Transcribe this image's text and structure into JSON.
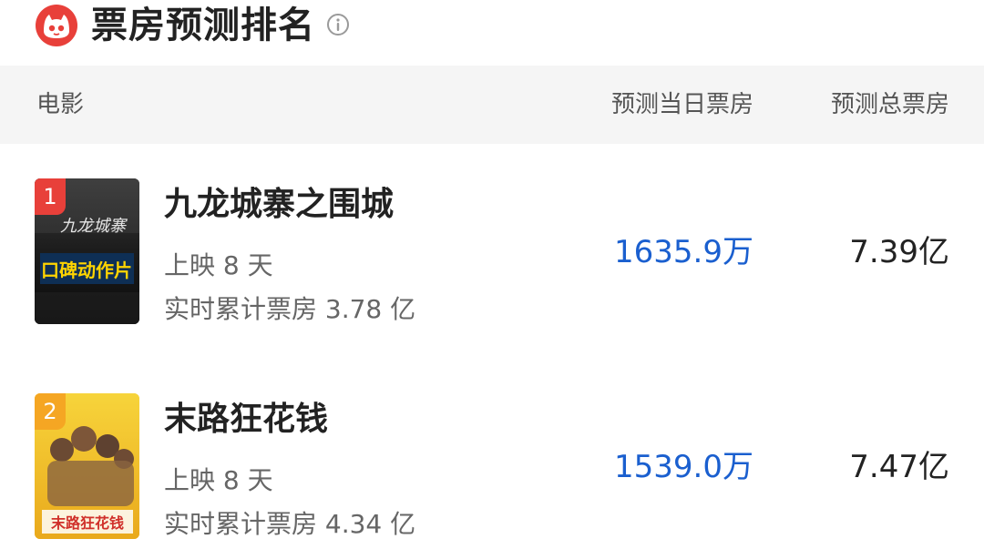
{
  "header": {
    "title": "票房预测排名",
    "logo_icon": "maoyan-cat-logo",
    "info_icon": "info-circle-icon",
    "brand_color": "#e8403a"
  },
  "columns": {
    "movie": "电影",
    "day_forecast": "预测当日票房",
    "total_forecast": "预测总票房"
  },
  "movies": [
    {
      "rank": "1",
      "rank_color": "#e8403a",
      "name": "九龙城寨之围城",
      "days": "上映 8 天",
      "cumulative": "实时累计票房 3.78 亿",
      "day_forecast": "1635.9万",
      "total_forecast": "7.39亿",
      "poster_text": "口碑动作片",
      "poster_title": "九龙城寨"
    },
    {
      "rank": "2",
      "rank_color": "#f5a623",
      "name": "末路狂花钱",
      "days": "上映 8 天",
      "cumulative": "实时累计票房 4.34 亿",
      "day_forecast": "1539.0万",
      "total_forecast": "7.47亿",
      "poster_text": "末路狂花钱"
    }
  ],
  "colors": {
    "day_value": "#1a5fcf",
    "header_bg": "#f5f5f5"
  }
}
